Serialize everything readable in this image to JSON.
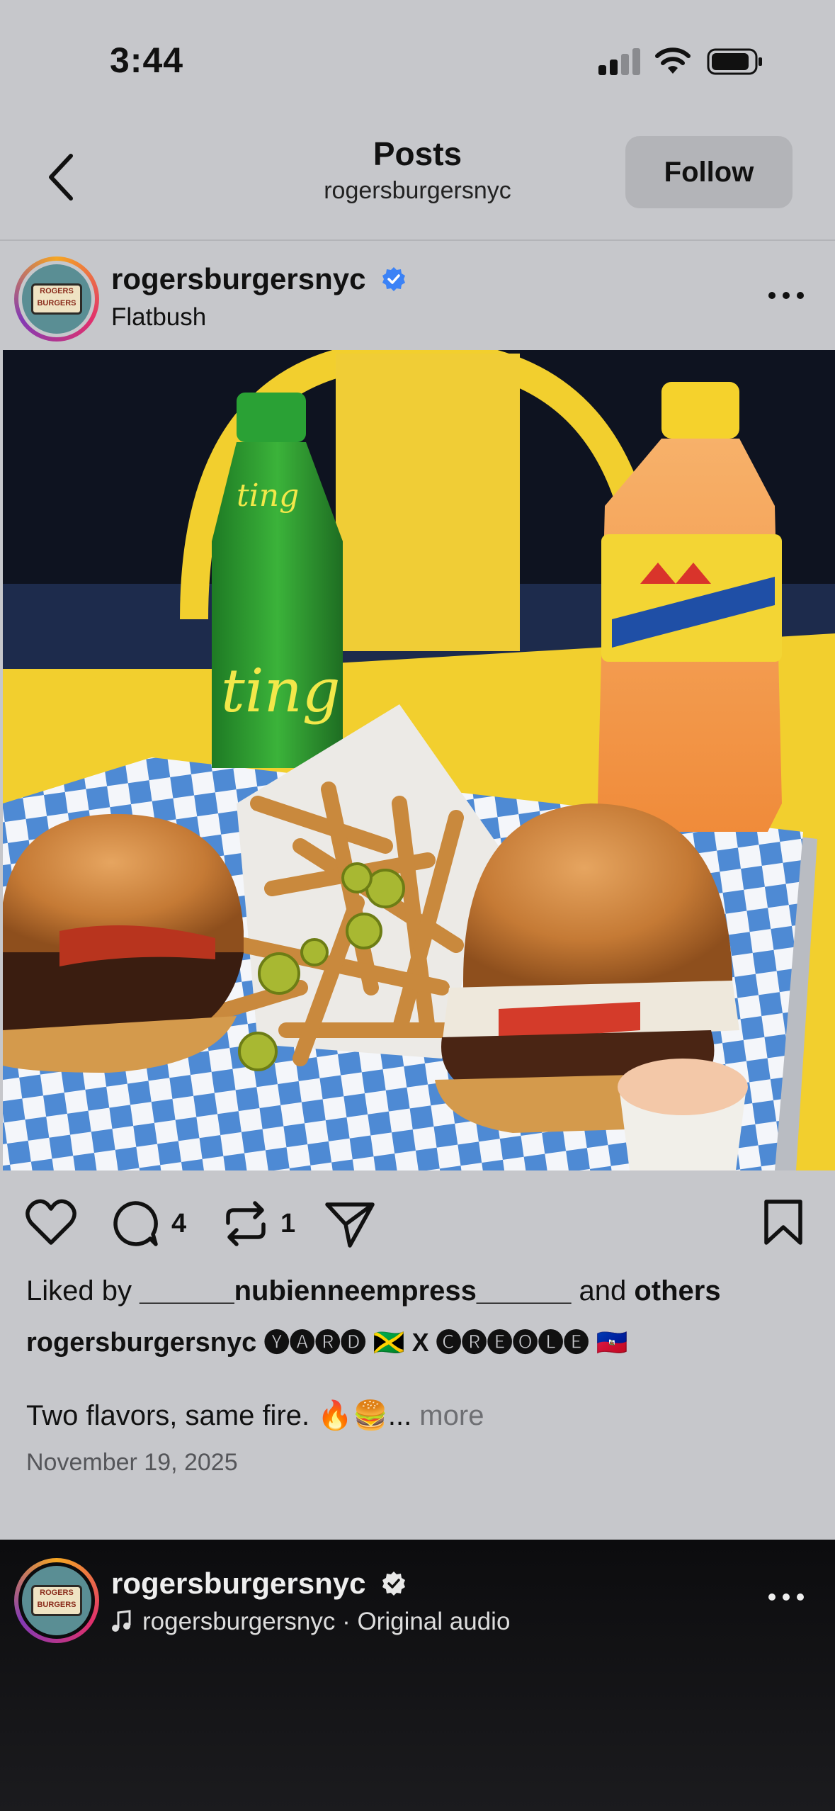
{
  "status_bar": {
    "time": "3:44"
  },
  "header": {
    "title": "Posts",
    "subtitle": "rogersburgersnyc",
    "follow_label": "Follow"
  },
  "post": {
    "username": "rogersburgersnyc",
    "location": "Flatbush",
    "avatar_text": "ROGERS BURGERS",
    "comment_count": "4",
    "repost_count": "1",
    "liked_by_prefix": "Liked by ",
    "liked_by_user": "______nubienneempress______",
    "liked_by_mid": " and ",
    "liked_by_suffix": "others",
    "caption_username": "rogersburgersnyc",
    "caption_tag": "🅨🅐🅡🅓 🇯🇲 X 🅒🅡🅔🅞🅛🅔 🇭🇹",
    "caption_text": "Two flavors, same fire. 🔥🍔...",
    "more_label": " more",
    "date": "November 19, 2025"
  },
  "next_post": {
    "username": "rogersburgersnyc",
    "audio": "rogersburgersnyc · Original audio"
  },
  "colors": {
    "background": "#c6c7cb",
    "table_yellow": "#f2cf2e",
    "verified_blue": "#3b82f6"
  },
  "icons": [
    "back-chevron-icon",
    "heart-icon",
    "comment-icon",
    "repost-icon",
    "share-icon",
    "bookmark-icon",
    "more-icon",
    "verified-badge-icon",
    "music-note-icon"
  ]
}
